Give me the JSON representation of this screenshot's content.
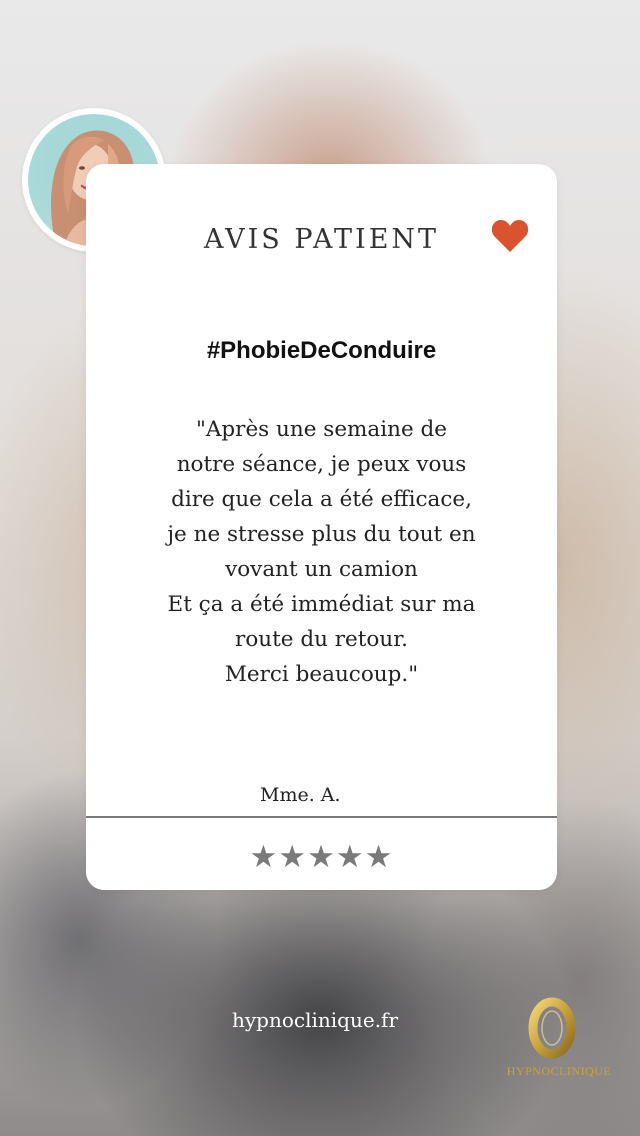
{
  "card": {
    "title": "AVIS PATIENT",
    "hashtag": "#PhobieDeConduire",
    "quote_lines": [
      "\"Après une semaine de",
      "notre séance, je peux vous",
      "dire que cela a été efficace,",
      "je ne stresse plus du tout en",
      "vovant un camion",
      "Et ça a été immédiat sur ma",
      "route du retour.",
      "Merci beaucoup.\""
    ],
    "author": "Mme. A.",
    "rating": {
      "stars_text": "★★★★★",
      "value": 5,
      "max": 5
    },
    "heart_color": "#d9532f"
  },
  "footer": {
    "website": "hypnoclinique.fr",
    "logo_text": "HYPNOCLINIQUE",
    "logo_color": "#c9a23c"
  },
  "icons": {
    "heart": "heart-icon",
    "star": "star-icon",
    "logo": "gold-ring-logo"
  }
}
